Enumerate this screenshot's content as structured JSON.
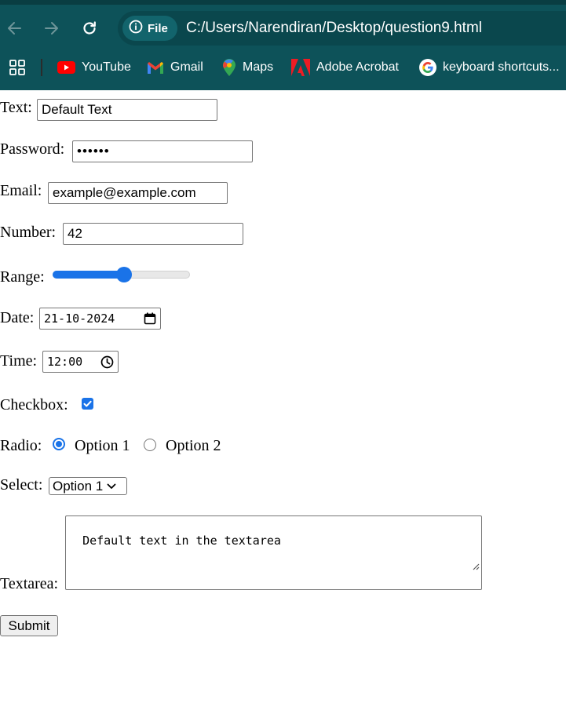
{
  "browser": {
    "site_chip_label": "File",
    "url": "C:/Users/Narendiran/Desktop/question9.html",
    "bookmarks": [
      {
        "label": "YouTube",
        "icon": "youtube-icon"
      },
      {
        "label": "Gmail",
        "icon": "gmail-icon"
      },
      {
        "label": "Maps",
        "icon": "maps-icon"
      },
      {
        "label": "Adobe Acrobat",
        "icon": "adobe-acrobat-icon"
      },
      {
        "label": "keyboard shortcuts...",
        "icon": "google-icon"
      }
    ],
    "colors": {
      "toolbar": "#0d5259",
      "accent": "#1a73e8"
    }
  },
  "form": {
    "text": {
      "label": "Text:",
      "value": "Default Text"
    },
    "password": {
      "label": "Password:",
      "value": "••••••"
    },
    "email": {
      "label": "Email:",
      "value": "example@example.com"
    },
    "number": {
      "label": "Number:",
      "value": "42"
    },
    "range": {
      "label": "Range:",
      "value": 0.5
    },
    "date": {
      "label": "Date:",
      "value": "21-10-2024"
    },
    "time": {
      "label": "Time:",
      "value": "12:00"
    },
    "checkbox": {
      "label": "Checkbox:",
      "checked": true
    },
    "radio": {
      "label": "Radio:",
      "options": [
        "Option 1",
        "Option 2"
      ],
      "selected": "Option 1"
    },
    "select": {
      "label": "Select:",
      "value": "Option 1"
    },
    "textarea": {
      "label": "Textarea:",
      "value": "Default text in the textarea"
    },
    "submit_label": "Submit"
  }
}
